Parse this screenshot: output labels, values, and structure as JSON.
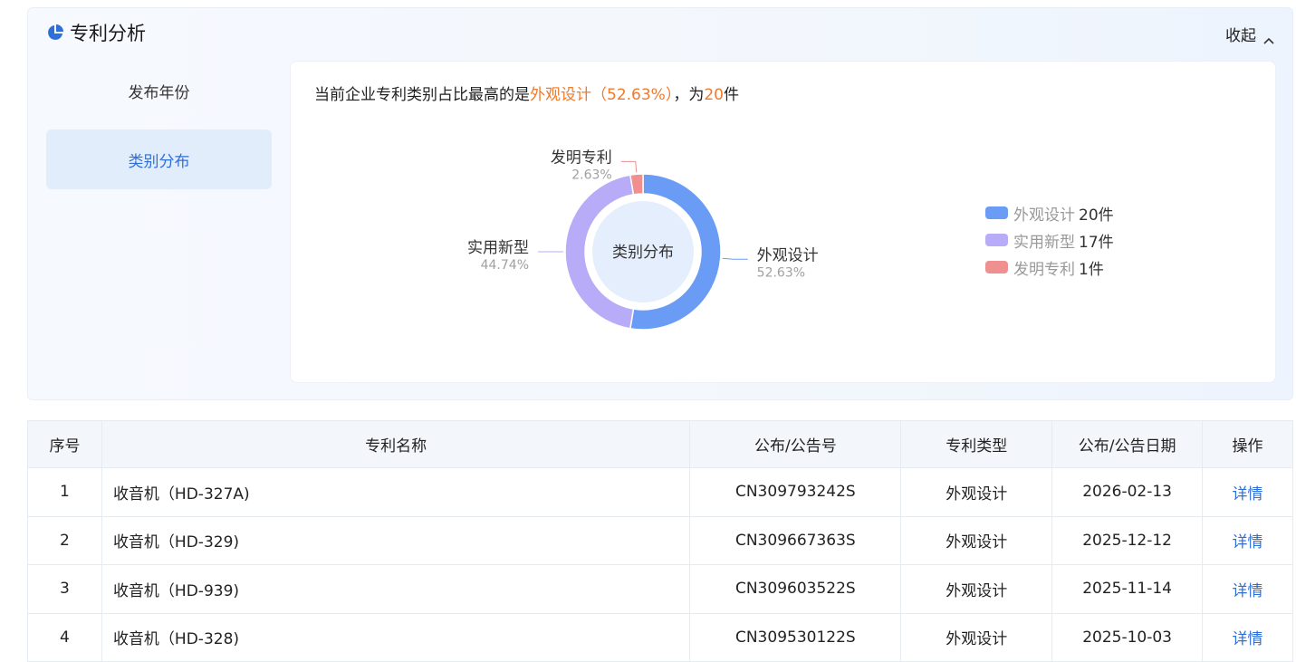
{
  "panel": {
    "title": "专利分析",
    "collapse_label": "收起",
    "tabs": [
      {
        "label": "发布年份",
        "active": false
      },
      {
        "label": "类别分布",
        "active": true
      }
    ]
  },
  "summary": {
    "prefix": "当前企业专利类别占比最高的是",
    "highlight_category": "外观设计（52.63%）",
    "middle": "，为",
    "highlight_count": "20",
    "suffix": "件"
  },
  "chart_data": {
    "type": "pie",
    "center_label": "类别分布",
    "categories": [
      "外观设计",
      "实用新型",
      "发明专利"
    ],
    "values": [
      20,
      17,
      1
    ],
    "percent_labels": [
      "52.63%",
      "44.74%",
      "2.63%"
    ],
    "colors": [
      "#6a9cf5",
      "#b8acf8",
      "#ef8f8f"
    ],
    "legend": [
      {
        "label": "外观设计",
        "count": "20件"
      },
      {
        "label": "实用新型",
        "count": "17件"
      },
      {
        "label": "发明专利",
        "count": "1件"
      }
    ],
    "legend_position": "right"
  },
  "table": {
    "headers": [
      "序号",
      "专利名称",
      "公布/公告号",
      "专利类型",
      "公布/公告日期",
      "操作"
    ],
    "rows": [
      [
        "1",
        "收音机（HD-327A)",
        "CN309793242S",
        "外观设计",
        "2026-02-13",
        "详情"
      ],
      [
        "2",
        "收音机（HD-329)",
        "CN309667363S",
        "外观设计",
        "2025-12-12",
        "详情"
      ],
      [
        "3",
        "收音机（HD-939)",
        "CN309603522S",
        "外观设计",
        "2025-11-14",
        "详情"
      ],
      [
        "4",
        "收音机（HD-328)",
        "CN309530122S",
        "外观设计",
        "2025-10-03",
        "详情"
      ]
    ]
  },
  "colors": {
    "accent": "#2f6fd8",
    "highlight": "#f07a2c"
  },
  "icons": {
    "title": "pie-chart-icon",
    "collapse": "chevron-up-icon"
  }
}
